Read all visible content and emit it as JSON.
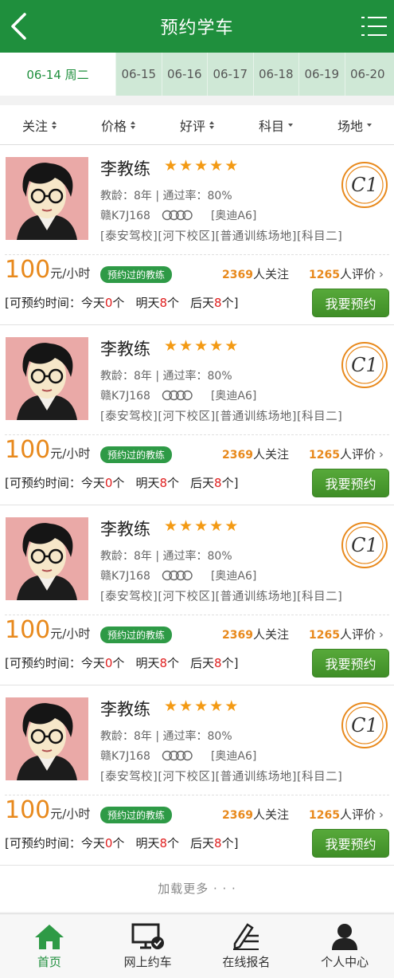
{
  "header": {
    "title": "预约学车"
  },
  "dates": [
    {
      "label": "06-14  周二",
      "active": true
    },
    {
      "label": "06-15"
    },
    {
      "label": "06-16"
    },
    {
      "label": "06-17"
    },
    {
      "label": "06-18"
    },
    {
      "label": "06-19"
    },
    {
      "label": "06-20"
    }
  ],
  "filters": [
    {
      "label": "关注",
      "arrow": "sort"
    },
    {
      "label": "价格",
      "arrow": "sort"
    },
    {
      "label": "好评",
      "arrow": "sort"
    },
    {
      "label": "科目",
      "arrow": "down"
    },
    {
      "label": "场地",
      "arrow": "down"
    }
  ],
  "coaches": [
    {
      "name": "李教练",
      "rating": 5,
      "license": "C1",
      "info1": "教龄：8年  |  通过率：80%",
      "plate": "赣K7J168",
      "car": "[奥迪A6]",
      "tags": "[泰安驾校][河下校区][普通训练场地][科目二]",
      "price": "100",
      "unit": "元/小时",
      "badge": "预约过的教练",
      "followers": "2369",
      "follow_label": "人关注",
      "reviews": "1265",
      "review_label": "人评价",
      "avail_label": "[可预约时间：",
      "today": "今天",
      "today_n": "0",
      "tomorrow": "明天",
      "tomorrow_n": "8",
      "after": "后天",
      "after_n": "8",
      "unit_ge": "个",
      "close": "]",
      "button": "我要预约"
    },
    {
      "name": "李教练",
      "rating": 5,
      "license": "C1",
      "info1": "教龄：8年  |  通过率：80%",
      "plate": "赣K7J168",
      "car": "[奥迪A6]",
      "tags": "[泰安驾校][河下校区][普通训练场地][科目二]",
      "price": "100",
      "unit": "元/小时",
      "badge": "预约过的教练",
      "followers": "2369",
      "follow_label": "人关注",
      "reviews": "1265",
      "review_label": "人评价",
      "avail_label": "[可预约时间：",
      "today": "今天",
      "today_n": "0",
      "tomorrow": "明天",
      "tomorrow_n": "8",
      "after": "后天",
      "after_n": "8",
      "unit_ge": "个",
      "close": "]",
      "button": "我要预约"
    },
    {
      "name": "李教练",
      "rating": 5,
      "license": "C1",
      "info1": "教龄：8年  |  通过率：80%",
      "plate": "赣K7J168",
      "car": "[奥迪A6]",
      "tags": "[泰安驾校][河下校区][普通训练场地][科目二]",
      "price": "100",
      "unit": "元/小时",
      "badge": "预约过的教练",
      "followers": "2369",
      "follow_label": "人关注",
      "reviews": "1265",
      "review_label": "人评价",
      "avail_label": "[可预约时间：",
      "today": "今天",
      "today_n": "0",
      "tomorrow": "明天",
      "tomorrow_n": "8",
      "after": "后天",
      "after_n": "8",
      "unit_ge": "个",
      "close": "]",
      "button": "我要预约"
    },
    {
      "name": "李教练",
      "rating": 5,
      "license": "C1",
      "info1": "教龄：8年  |  通过率：80%",
      "plate": "赣K7J168",
      "car": "[奥迪A6]",
      "tags": "[泰安驾校][河下校区][普通训练场地][科目二]",
      "price": "100",
      "unit": "元/小时",
      "badge": "预约过的教练",
      "followers": "2369",
      "follow_label": "人关注",
      "reviews": "1265",
      "review_label": "人评价",
      "avail_label": "[可预约时间：",
      "today": "今天",
      "today_n": "0",
      "tomorrow": "明天",
      "tomorrow_n": "8",
      "after": "后天",
      "after_n": "8",
      "unit_ge": "个",
      "close": "]",
      "button": "我要预约"
    }
  ],
  "load_more": "加载更多 · · ·",
  "tabbar": [
    {
      "label": "首页",
      "icon": "home-icon",
      "active": true
    },
    {
      "label": "网上约车",
      "icon": "monitor-check-icon"
    },
    {
      "label": "在线报名",
      "icon": "pen-form-icon"
    },
    {
      "label": "个人中心",
      "icon": "user-icon"
    }
  ],
  "colors": {
    "brand": "#1f8f3d",
    "accent": "#e8891c",
    "star": "#f39a14",
    "button": "#4a9d30"
  }
}
